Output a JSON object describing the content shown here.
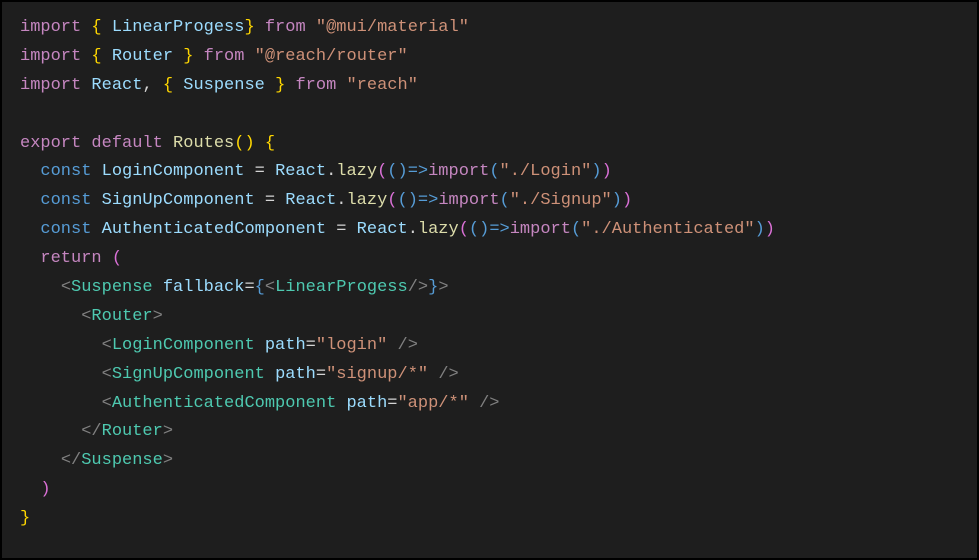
{
  "tokens": [
    [
      {
        "c": "kw-import",
        "t": "import"
      },
      {
        "c": "punct",
        "t": " "
      },
      {
        "c": "brace",
        "t": "{"
      },
      {
        "c": "punct",
        "t": " "
      },
      {
        "c": "ident",
        "t": "LinearProgess"
      },
      {
        "c": "brace",
        "t": "}"
      },
      {
        "c": "punct",
        "t": " "
      },
      {
        "c": "kw-from",
        "t": "from"
      },
      {
        "c": "punct",
        "t": " "
      },
      {
        "c": "str",
        "t": "\"@mui/material\""
      }
    ],
    [
      {
        "c": "kw-import",
        "t": "import"
      },
      {
        "c": "punct",
        "t": " "
      },
      {
        "c": "brace",
        "t": "{"
      },
      {
        "c": "punct",
        "t": " "
      },
      {
        "c": "ident",
        "t": "Router"
      },
      {
        "c": "punct",
        "t": " "
      },
      {
        "c": "brace",
        "t": "}"
      },
      {
        "c": "punct",
        "t": " "
      },
      {
        "c": "kw-from",
        "t": "from"
      },
      {
        "c": "punct",
        "t": " "
      },
      {
        "c": "str",
        "t": "\"@reach/router\""
      }
    ],
    [
      {
        "c": "kw-import",
        "t": "import"
      },
      {
        "c": "punct",
        "t": " "
      },
      {
        "c": "ident",
        "t": "React"
      },
      {
        "c": "punct",
        "t": ", "
      },
      {
        "c": "brace",
        "t": "{"
      },
      {
        "c": "punct",
        "t": " "
      },
      {
        "c": "ident",
        "t": "Suspense"
      },
      {
        "c": "punct",
        "t": " "
      },
      {
        "c": "brace",
        "t": "}"
      },
      {
        "c": "punct",
        "t": " "
      },
      {
        "c": "kw-from",
        "t": "from"
      },
      {
        "c": "punct",
        "t": " "
      },
      {
        "c": "str",
        "t": "\"reach\""
      }
    ],
    [],
    [
      {
        "c": "kw-export",
        "t": "export"
      },
      {
        "c": "punct",
        "t": " "
      },
      {
        "c": "kw-default",
        "t": "default"
      },
      {
        "c": "punct",
        "t": " "
      },
      {
        "c": "func",
        "t": "Routes"
      },
      {
        "c": "paren",
        "t": "()"
      },
      {
        "c": "punct",
        "t": " "
      },
      {
        "c": "brace",
        "t": "{"
      }
    ],
    [
      {
        "c": "punct",
        "t": "  "
      },
      {
        "c": "kw-const",
        "t": "const"
      },
      {
        "c": "punct",
        "t": " "
      },
      {
        "c": "ident",
        "t": "LoginComponent"
      },
      {
        "c": "punct",
        "t": " = "
      },
      {
        "c": "ident",
        "t": "React"
      },
      {
        "c": "punct",
        "t": "."
      },
      {
        "c": "func",
        "t": "lazy"
      },
      {
        "c": "paren2",
        "t": "("
      },
      {
        "c": "paren3",
        "t": "()"
      },
      {
        "c": "arrow",
        "t": "=>"
      },
      {
        "c": "kw-import",
        "t": "import"
      },
      {
        "c": "paren3",
        "t": "("
      },
      {
        "c": "str",
        "t": "\"./Login\""
      },
      {
        "c": "paren3",
        "t": ")"
      },
      {
        "c": "paren2",
        "t": ")"
      }
    ],
    [
      {
        "c": "punct",
        "t": "  "
      },
      {
        "c": "kw-const",
        "t": "const"
      },
      {
        "c": "punct",
        "t": " "
      },
      {
        "c": "ident",
        "t": "SignUpComponent"
      },
      {
        "c": "punct",
        "t": " = "
      },
      {
        "c": "ident",
        "t": "React"
      },
      {
        "c": "punct",
        "t": "."
      },
      {
        "c": "func",
        "t": "lazy"
      },
      {
        "c": "paren2",
        "t": "("
      },
      {
        "c": "paren3",
        "t": "()"
      },
      {
        "c": "arrow",
        "t": "=>"
      },
      {
        "c": "kw-import",
        "t": "import"
      },
      {
        "c": "paren3",
        "t": "("
      },
      {
        "c": "str",
        "t": "\"./Signup\""
      },
      {
        "c": "paren3",
        "t": ")"
      },
      {
        "c": "paren2",
        "t": ")"
      }
    ],
    [
      {
        "c": "punct",
        "t": "  "
      },
      {
        "c": "kw-const",
        "t": "const"
      },
      {
        "c": "punct",
        "t": " "
      },
      {
        "c": "ident",
        "t": "AuthenticatedComponent"
      },
      {
        "c": "punct",
        "t": " = "
      },
      {
        "c": "ident",
        "t": "React"
      },
      {
        "c": "punct",
        "t": "."
      },
      {
        "c": "func",
        "t": "lazy"
      },
      {
        "c": "paren2",
        "t": "("
      },
      {
        "c": "paren3",
        "t": "()"
      },
      {
        "c": "arrow",
        "t": "=>"
      },
      {
        "c": "kw-import",
        "t": "import"
      },
      {
        "c": "paren3",
        "t": "("
      },
      {
        "c": "str",
        "t": "\"./Authenticated\""
      },
      {
        "c": "paren3",
        "t": ")"
      },
      {
        "c": "paren2",
        "t": ")"
      }
    ],
    [
      {
        "c": "punct",
        "t": "  "
      },
      {
        "c": "kw-return",
        "t": "return"
      },
      {
        "c": "punct",
        "t": " "
      },
      {
        "c": "paren2",
        "t": "("
      }
    ],
    [
      {
        "c": "punct",
        "t": "    "
      },
      {
        "c": "tag",
        "t": "<"
      },
      {
        "c": "component",
        "t": "Suspense"
      },
      {
        "c": "punct",
        "t": " "
      },
      {
        "c": "attr",
        "t": "fallback"
      },
      {
        "c": "eq",
        "t": "="
      },
      {
        "c": "brace3",
        "t": "{"
      },
      {
        "c": "tag",
        "t": "<"
      },
      {
        "c": "component",
        "t": "LinearProgess"
      },
      {
        "c": "tag",
        "t": "/>"
      },
      {
        "c": "brace3",
        "t": "}"
      },
      {
        "c": "tag",
        "t": ">"
      }
    ],
    [
      {
        "c": "punct",
        "t": "      "
      },
      {
        "c": "tag",
        "t": "<"
      },
      {
        "c": "component",
        "t": "Router"
      },
      {
        "c": "tag",
        "t": ">"
      }
    ],
    [
      {
        "c": "punct",
        "t": "        "
      },
      {
        "c": "tag",
        "t": "<"
      },
      {
        "c": "component",
        "t": "LoginComponent"
      },
      {
        "c": "punct",
        "t": " "
      },
      {
        "c": "attr",
        "t": "path"
      },
      {
        "c": "eq",
        "t": "="
      },
      {
        "c": "str",
        "t": "\"login\""
      },
      {
        "c": "punct",
        "t": " "
      },
      {
        "c": "tag",
        "t": "/>"
      }
    ],
    [
      {
        "c": "punct",
        "t": "        "
      },
      {
        "c": "tag",
        "t": "<"
      },
      {
        "c": "component",
        "t": "SignUpComponent"
      },
      {
        "c": "punct",
        "t": " "
      },
      {
        "c": "attr",
        "t": "path"
      },
      {
        "c": "eq",
        "t": "="
      },
      {
        "c": "str",
        "t": "\"signup/*\""
      },
      {
        "c": "punct",
        "t": " "
      },
      {
        "c": "tag",
        "t": "/>"
      }
    ],
    [
      {
        "c": "punct",
        "t": "        "
      },
      {
        "c": "tag",
        "t": "<"
      },
      {
        "c": "component",
        "t": "AuthenticatedComponent"
      },
      {
        "c": "punct",
        "t": " "
      },
      {
        "c": "attr",
        "t": "path"
      },
      {
        "c": "eq",
        "t": "="
      },
      {
        "c": "str",
        "t": "\"app/*\""
      },
      {
        "c": "punct",
        "t": " "
      },
      {
        "c": "tag",
        "t": "/>"
      }
    ],
    [
      {
        "c": "punct",
        "t": "      "
      },
      {
        "c": "tag",
        "t": "</"
      },
      {
        "c": "component",
        "t": "Router"
      },
      {
        "c": "tag",
        "t": ">"
      }
    ],
    [
      {
        "c": "punct",
        "t": "    "
      },
      {
        "c": "tag",
        "t": "</"
      },
      {
        "c": "component",
        "t": "Suspense"
      },
      {
        "c": "tag",
        "t": ">"
      }
    ],
    [
      {
        "c": "punct",
        "t": "  "
      },
      {
        "c": "paren2",
        "t": ")"
      }
    ],
    [
      {
        "c": "brace",
        "t": "}"
      }
    ]
  ]
}
